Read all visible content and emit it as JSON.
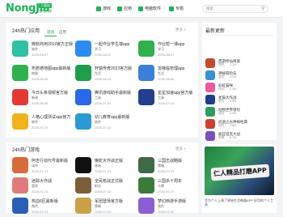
{
  "header": {
    "logo": "NongJia",
    "logo_badge": "下载站",
    "logo_sub": "游戏资源",
    "nav": [
      {
        "label": "游戏",
        "icon": "gamepad-icon"
      },
      {
        "label": "应用",
        "icon": "apps-icon"
      },
      {
        "label": "电脑软件",
        "icon": "desktop-icon"
      },
      {
        "label": "专题",
        "icon": "topic-icon"
      }
    ],
    "search_placeholder": "搜索"
  },
  "hot_apps": {
    "title": "24h热门应用",
    "more": "更多 >",
    "items": [
      {
        "name": "微软商用2019官方正版",
        "tag": "软件",
        "date": "2025-08-07",
        "color": "#2fc0a5"
      },
      {
        "name": "一起作业学生端app",
        "tag": "学习",
        "date": "2025-08-22",
        "color": "#2d8cf0"
      },
      {
        "name": "作业帮一课app",
        "tag": "学习",
        "date": "2025-08-27",
        "color": "#2fb14e"
      },
      {
        "name": "布若德地图app最新版",
        "tag": "地图",
        "date": "2025-08-05",
        "color": "#2fb14e"
      },
      {
        "name": "轩辕传奇2023官方版",
        "tag": "生活",
        "date": "2025-08-03",
        "color": "#1e9e4a"
      },
      {
        "name": "雷锋临管理app",
        "tag": "生活",
        "date": "2025-08-06",
        "color": "#3a7fd8"
      },
      {
        "name": "今日头条视频官方版",
        "tag": "新闻",
        "date": "2025-08-06",
        "color": "#e53935"
      },
      {
        "name": "腾讯游戏助手最新版",
        "tag": "工具",
        "date": "2025-07-31",
        "color": "#2a68e8"
      },
      {
        "name": "星星加速app官方版",
        "tag": "工具",
        "date": "2025-07-23",
        "color": "#243f8f"
      },
      {
        "name": "人格心理测试app官方",
        "tag": "软件",
        "date": "2025-07-23",
        "color": "#f2b21c"
      },
      {
        "name": "幼儿教育app最新版",
        "tag": "软件",
        "date": "2025-07-22",
        "color": "#2b9ad3"
      }
    ]
  },
  "hot_games": {
    "title": "24h热门游戏",
    "more": "更多 >",
    "items": [
      {
        "name": "阿吉行动代号最新版",
        "tag": "动作",
        "date": "2025-07-17",
        "color": "#d96a3b"
      },
      {
        "name": "懒蛇大作战正版",
        "tag": "休闲",
        "date": "2025-07-23",
        "color": "#111111"
      },
      {
        "name": "三国志战略版",
        "tag": "策略",
        "date": "2025-07-21",
        "color": "#3f6a45"
      },
      {
        "name": "迷踪大作战",
        "tag": "冒险",
        "date": "2025-07-21",
        "color": "#e07b7b"
      },
      {
        "name": "全民枪战正式版",
        "tag": "射击",
        "date": "2025-07-22",
        "color": "#7b5e3a"
      },
      {
        "name": "三国杀十周年",
        "tag": "卡牌",
        "date": "2025-07-22",
        "color": "#3c7a3c"
      },
      {
        "name": "热血6区最新版",
        "tag": "角色",
        "date": "2025-07-21",
        "color": "#2b5fb4"
      },
      {
        "name": "军团登场官方版",
        "tag": "策略",
        "date": "2025-07-20",
        "color": "#caa147"
      },
      {
        "name": "梦幻西游手游版",
        "tag": "角色",
        "date": "2025-07-20",
        "color": "#8a5fd1"
      }
    ]
  },
  "ranking": {
    "title": "最新更新",
    "more": "更多",
    "tabs": [
      {
        "label": "游戏",
        "active": true
      },
      {
        "label": "应用",
        "active": false
      }
    ],
    "items": [
      {
        "name": "西游修仙奇旅",
        "meta": "角色",
        "meta2": "1.1M",
        "color": "#c64a2d"
      },
      {
        "name": "神秘冒险岛",
        "meta": "冒险",
        "meta2": "1.2M",
        "color": "#3a8fd8"
      },
      {
        "name": "彩虹猫咪",
        "meta": "休闲",
        "meta2": "2.3M",
        "color": "#ea5aa0"
      },
      {
        "name": "星辰大作战",
        "meta": "射击",
        "meta2": "3.5M",
        "color": "#1d3d8f"
      },
      {
        "name": "动物世界冒险",
        "meta": "冒险",
        "meta2": "4.6M",
        "color": "#2e9b62"
      },
      {
        "name": "问道之光神探经典",
        "meta": "角色",
        "meta2": "5.6M",
        "color": "#d1402f"
      },
      {
        "name": "疯狂坦克大战",
        "meta": "策略",
        "meta2": "6.7M",
        "color": "#7a4fbf"
      }
    ]
  },
  "banner": {
    "overlay": "仁人精品打磨APP",
    "caption": "华为个人上线了原始生活神器APP 好用的个人工具"
  }
}
